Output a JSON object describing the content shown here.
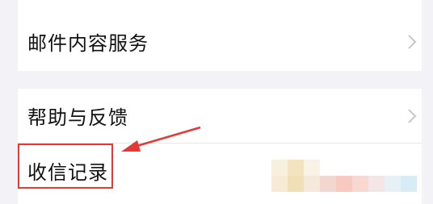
{
  "settings": {
    "section_mail": {
      "items": [
        {
          "label": "邮件内容服务"
        }
      ]
    },
    "section_help": {
      "items": [
        {
          "label": "帮助与反馈"
        },
        {
          "label": "收信记录"
        }
      ]
    }
  },
  "annotation": {
    "highlight_color": "#e53935",
    "arrow_color": "#e53935"
  },
  "colors": {
    "background": "#f2f2f7",
    "row_background": "#ffffff",
    "chevron": "#c7c7cc",
    "text": "#111111"
  },
  "icons": {
    "chevron": "chevron-right-icon",
    "arrow": "red-arrow-icon"
  }
}
